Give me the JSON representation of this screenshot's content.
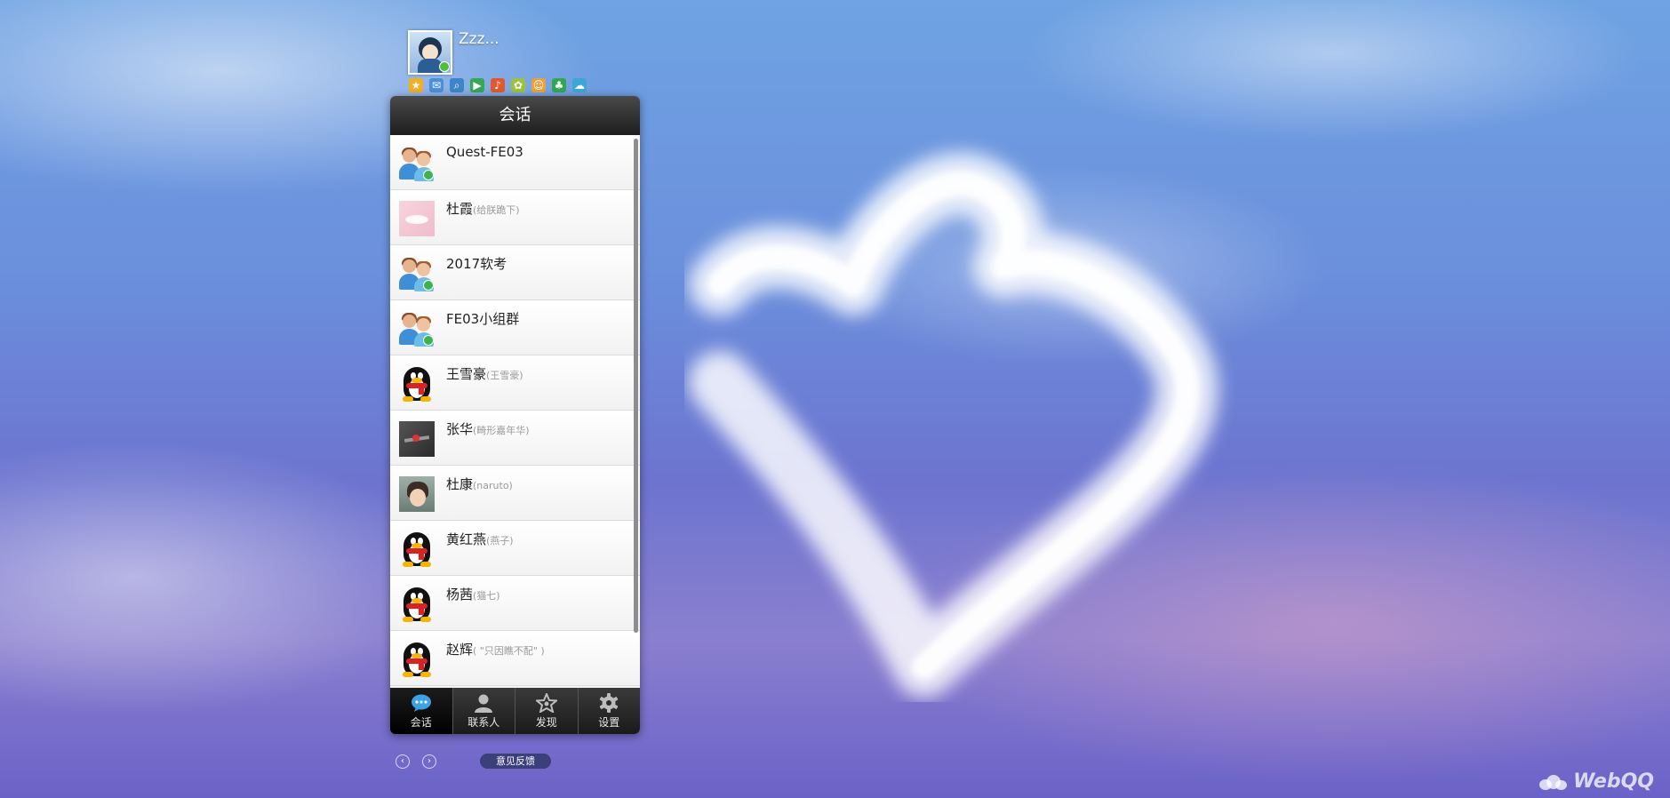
{
  "profile": {
    "nickname": "Zzz..."
  },
  "app_icons": [
    "star-icon",
    "mail-icon",
    "search-icon",
    "video-icon",
    "music-icon",
    "gift-icon",
    "pet-icon",
    "clover-icon",
    "cloud-icon"
  ],
  "panel": {
    "title": "会话"
  },
  "conversations": [
    {
      "name": "Quest-FE03",
      "remark": "",
      "avatar": "group"
    },
    {
      "name": "杜霞",
      "remark": "(给朕跪下)",
      "avatar": "pink-photo"
    },
    {
      "name": "2017软考",
      "remark": "",
      "avatar": "group"
    },
    {
      "name": "FE03小组群",
      "remark": "",
      "avatar": "group"
    },
    {
      "name": "王雪豪",
      "remark": "(王雪豪)",
      "avatar": "penguin"
    },
    {
      "name": "张华",
      "remark": "(畸形嘉年华)",
      "avatar": "dark-photo"
    },
    {
      "name": "杜康",
      "remark": "(naruto)",
      "avatar": "anime-photo"
    },
    {
      "name": "黄红燕",
      "remark": "(燕子)",
      "avatar": "penguin"
    },
    {
      "name": "杨茜",
      "remark": "(猫七)",
      "avatar": "penguin"
    },
    {
      "name": "赵辉",
      "remark": "( \"只因瞧不配\" )",
      "avatar": "penguin"
    }
  ],
  "bottom_nav": [
    {
      "label": "会话",
      "icon": "chat-bubble-icon",
      "active": true
    },
    {
      "label": "联系人",
      "icon": "contacts-icon",
      "active": false
    },
    {
      "label": "发现",
      "icon": "discover-icon",
      "active": false
    },
    {
      "label": "设置",
      "icon": "settings-icon",
      "active": false
    }
  ],
  "footer": {
    "prev": "‹",
    "next": "›",
    "feedback": "意见反馈",
    "brand": "WebQQ"
  },
  "colors": {
    "header": "#1e1e1e",
    "accent_blue": "#3aa3e8",
    "sky": "#6b8fdc"
  }
}
